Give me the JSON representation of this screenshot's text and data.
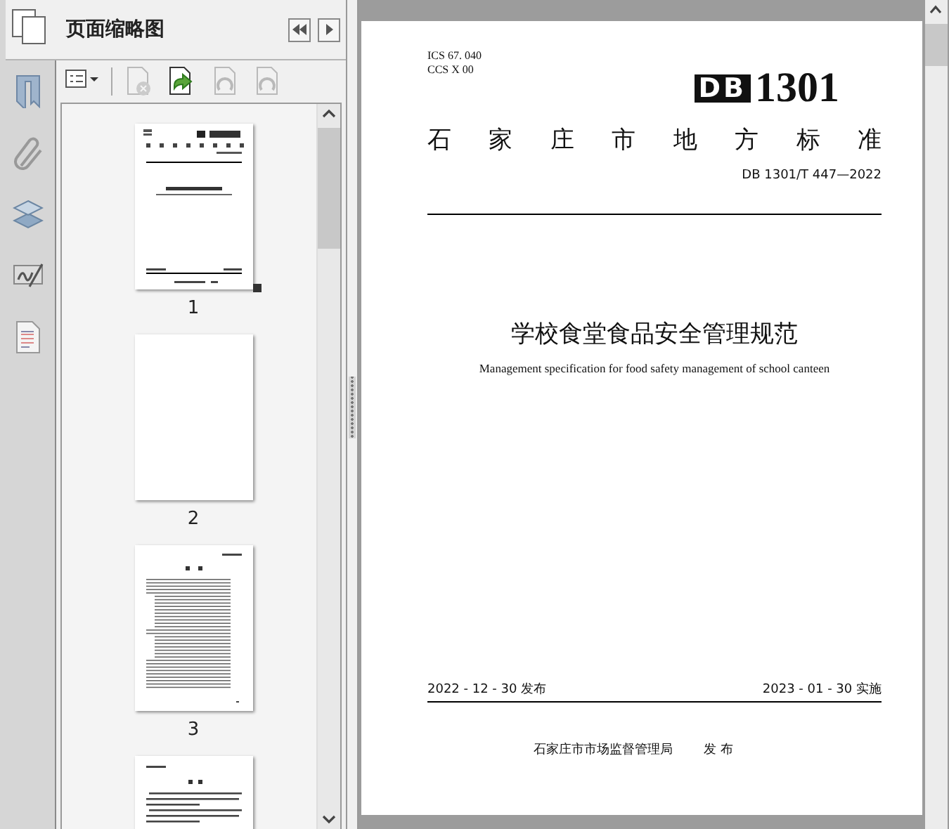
{
  "panel": {
    "title": "页面缩略图"
  },
  "toolbar": [
    {
      "kind": "options",
      "disabled": false
    },
    {
      "kind": "delete",
      "disabled": true
    },
    {
      "kind": "insert",
      "disabled": false
    },
    {
      "kind": "rotate-left",
      "disabled": true
    },
    {
      "kind": "rotate-right",
      "disabled": true
    }
  ],
  "thumbnails": [
    {
      "kind": "cover",
      "label": "1",
      "current": true
    },
    {
      "kind": "blank",
      "label": "2",
      "current": false
    },
    {
      "kind": "contents",
      "label": "3",
      "current": false
    },
    {
      "kind": "text",
      "current": false
    }
  ],
  "document": {
    "ics": "ICS  67. 040",
    "ccs": "CCS  X  00",
    "logo_mark": "DB",
    "logo_number": "1301",
    "category": "石家庄市地方标准",
    "code": "DB 1301/T  447—2022",
    "title": "学校食堂食品安全管理规范",
    "subtitle": "Management specification for food safety management of school canteen",
    "issue_date": "2022 - 12 - 30 发布",
    "effective_date": "2023 - 01 - 30 实施",
    "publisher": "石家庄市市场监督管理局",
    "publish_word": "发 布"
  }
}
